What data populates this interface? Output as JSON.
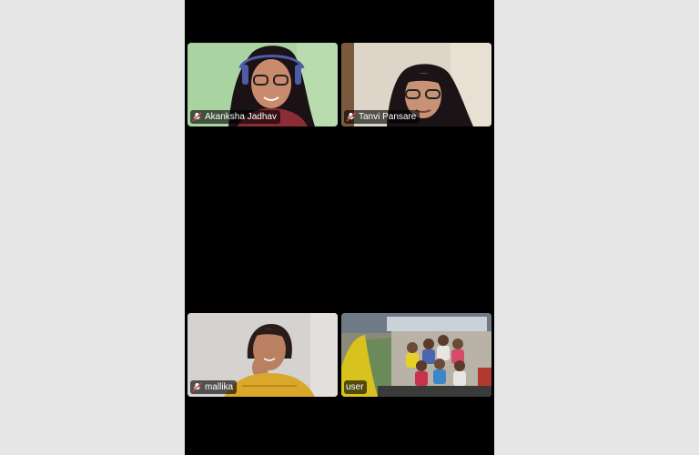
{
  "colors": {
    "call_background": "#000000",
    "page_background": "#e6e6e6",
    "name_tag_background": "rgba(0,0,0,0.62)"
  },
  "participants": [
    {
      "name": "Akanksha Jadhav",
      "mic_icon": "mic-muted-icon"
    },
    {
      "name": "Tanvi Pansare",
      "mic_icon": "mic-muted-icon"
    },
    {
      "name": "mallika",
      "mic_icon": "mic-muted-icon"
    },
    {
      "name": "user",
      "mic_icon": ""
    }
  ]
}
